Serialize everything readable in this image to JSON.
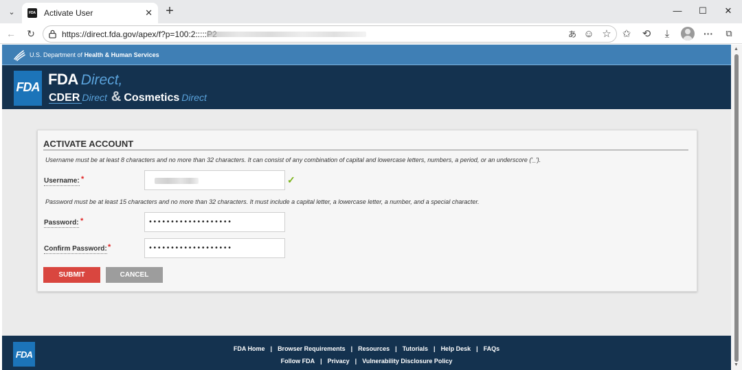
{
  "browser": {
    "tab_title": "Activate User",
    "tab_favicon_text": "FDA",
    "url": "https://direct.fda.gov/apex/f?p=100:2:::::P2"
  },
  "hhs_bar": {
    "prefix": "U.S. Department of",
    "bold": "Health & Human Services"
  },
  "header": {
    "logo_text": "FDA",
    "line1_strong": "FDA",
    "line1_light": "Direct,",
    "line2_a_strong": "CDER",
    "line2_a_light": "Direct",
    "line2_amp": "&",
    "line2_b_strong": "Cosmetics",
    "line2_b_light": "Direct"
  },
  "form": {
    "title": "ACTIVATE ACCOUNT",
    "username_hint": "Username must be at least 8 characters and no more than 32 characters. It can consist of any combination of capital and lowercase letters, numbers, a period, or an underscore ('_').",
    "username_label": "Username:",
    "password_hint": "Password must be at least 15 characters and no more than 32 characters. It must include a capital letter, a lowercase letter, a number, and a special character.",
    "password_label": "Password:",
    "password_value": "•••••••••••••••••••",
    "confirm_label": "Confirm Password:",
    "confirm_value": "•••••••••••••••••••",
    "required_marker": "*",
    "submit_label": "SUBMIT",
    "cancel_label": "CANCEL"
  },
  "footer": {
    "logo_text": "FDA",
    "row1": [
      "FDA Home",
      "Browser Requirements",
      "Resources",
      "Tutorials",
      "Help Desk",
      "FAQs"
    ],
    "row2": [
      "Follow FDA",
      "Privacy",
      "Vulnerability Disclosure Policy"
    ],
    "separator": "|"
  },
  "colors": {
    "hhs_blue": "#3f7fb5",
    "navy": "#14324f",
    "fda_blue": "#1c74b9",
    "submit_red": "#d9463f",
    "cancel_gray": "#9d9d9d",
    "valid_green": "#7ab317"
  }
}
